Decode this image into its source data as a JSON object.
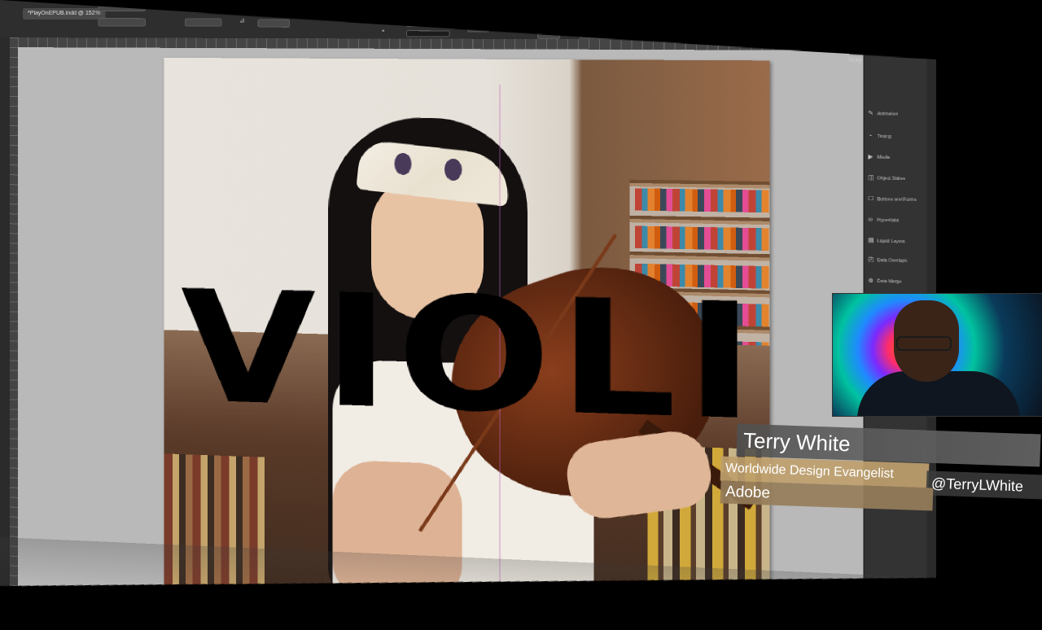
{
  "document": {
    "tab_label": "*PlayOnEPUB.indd @ 152%"
  },
  "control_bar": {
    "fill_stroke_icon": "fill-swatch-icon"
  },
  "header": {
    "user_name": "Terry White"
  },
  "page": {
    "headline": "VIOLIN"
  },
  "panels": {
    "items": [
      {
        "label": "Animation",
        "icon": "animation-icon"
      },
      {
        "label": "Timing",
        "icon": "timing-icon"
      },
      {
        "label": "Media",
        "icon": "media-icon"
      },
      {
        "label": "Object States",
        "icon": "object-states-icon"
      },
      {
        "label": "Buttons and Forms",
        "icon": "buttons-forms-icon"
      },
      {
        "label": "Hyperlinks",
        "icon": "hyperlinks-icon"
      },
      {
        "label": "Liquid Layout",
        "icon": "liquid-layout-icon"
      },
      {
        "label": "Data Overlays",
        "icon": "data-overlays-icon"
      },
      {
        "label": "Data Merge",
        "icon": "data-merge-icon"
      }
    ]
  },
  "lower_third": {
    "name": "Terry White",
    "title": "Worldwide Design Evangelist",
    "handle": "@TerryLWhite",
    "company": "Adobe"
  }
}
